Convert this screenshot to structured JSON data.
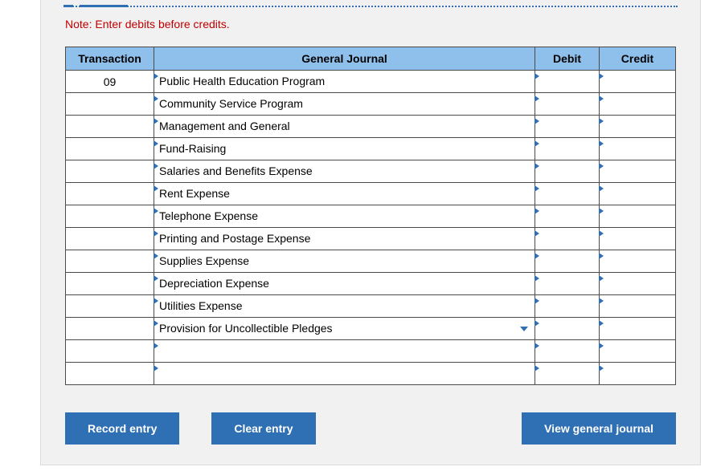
{
  "note": "Note: Enter debits before credits.",
  "headers": {
    "transaction": "Transaction",
    "general_journal": "General Journal",
    "debit": "Debit",
    "credit": "Credit"
  },
  "rows": [
    {
      "transaction": "09",
      "account": "Public Health Education Program",
      "debit": "",
      "credit": "",
      "dropdown": false
    },
    {
      "transaction": "",
      "account": "Community Service Program",
      "debit": "",
      "credit": "",
      "dropdown": false
    },
    {
      "transaction": "",
      "account": "Management and General",
      "debit": "",
      "credit": "",
      "dropdown": false
    },
    {
      "transaction": "",
      "account": "Fund-Raising",
      "debit": "",
      "credit": "",
      "dropdown": false
    },
    {
      "transaction": "",
      "account": "Salaries and Benefits Expense",
      "debit": "",
      "credit": "",
      "dropdown": false
    },
    {
      "transaction": "",
      "account": "Rent Expense",
      "debit": "",
      "credit": "",
      "dropdown": false
    },
    {
      "transaction": "",
      "account": "Telephone Expense",
      "debit": "",
      "credit": "",
      "dropdown": false
    },
    {
      "transaction": "",
      "account": "Printing and Postage Expense",
      "debit": "",
      "credit": "",
      "dropdown": false
    },
    {
      "transaction": "",
      "account": "Supplies Expense",
      "debit": "",
      "credit": "",
      "dropdown": false
    },
    {
      "transaction": "",
      "account": "Depreciation Expense",
      "debit": "",
      "credit": "",
      "dropdown": false
    },
    {
      "transaction": "",
      "account": "Utilities Expense",
      "debit": "",
      "credit": "",
      "dropdown": false
    },
    {
      "transaction": "",
      "account": "Provision for Uncollectible Pledges",
      "debit": "",
      "credit": "",
      "dropdown": true
    },
    {
      "transaction": "",
      "account": "",
      "debit": "",
      "credit": "",
      "dropdown": false
    },
    {
      "transaction": "",
      "account": "",
      "debit": "",
      "credit": "",
      "dropdown": false
    }
  ],
  "buttons": {
    "record": "Record entry",
    "clear": "Clear entry",
    "view": "View general journal"
  }
}
